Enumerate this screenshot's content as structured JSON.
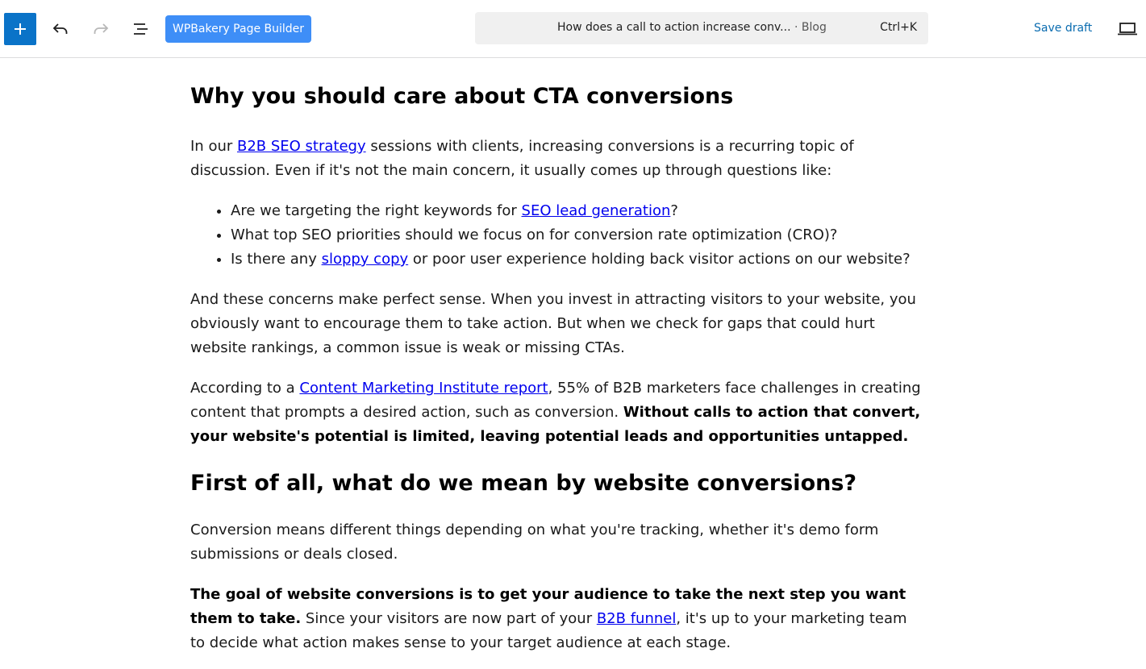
{
  "toolbar": {
    "add_icon": "plus-icon",
    "undo_icon": "undo-icon",
    "redo_icon": "redo-icon",
    "outline_icon": "document-overview-icon",
    "wpbakery_label": "WPBakery Page Builder",
    "doc_title": "How does a call to action increase conv...",
    "doc_type": "· Blog",
    "shortcut": "Ctrl+K",
    "save_draft_label": "Save draft",
    "preview_icon": "laptop-preview-icon",
    "accent_color": "#0a73c8",
    "wpbakery_color": "#3e8ef7"
  },
  "content": {
    "h_care": "Why you should care about CTA conversions",
    "p1": {
      "pre": "In our ",
      "link": "B2B SEO strategy",
      "post": " sessions with clients, increasing conversions is a recurring topic of discussion. Even if it's not the main concern, it usually comes up through questions like:"
    },
    "bullets": [
      {
        "pre": "Are we targeting the right keywords for ",
        "link": "SEO lead generation",
        "post": "?"
      },
      {
        "text": "What top SEO priorities should we focus on for conversion rate optimization (CRO)?"
      },
      {
        "pre": "Is there any ",
        "link": "sloppy copy",
        "post": " or poor user experience holding back visitor actions on our website?"
      }
    ],
    "p2": "And these concerns make perfect sense. When you invest in attracting visitors to your website, you obviously want to encourage them to take action. But when we check for gaps that could hurt website rankings, a common issue is weak or missing CTAs.",
    "p3": {
      "pre": "According to a ",
      "link": "Content Marketing Institute report",
      "mid": ", 55% of B2B marketers face challenges in creating content that prompts a desired action, such as conversion. ",
      "bold": "Without calls to action that convert, your website's potential is limited, leaving potential leads and opportunities untapped."
    },
    "h_first": "First of all, what do we mean by website conversions?",
    "p4": "Conversion means different things depending on what you're tracking, whether it's demo form submissions or deals closed.",
    "p5": {
      "bold": "The goal of website conversions is to get your audience to take the next step you want them to take.",
      "pre": " Since your visitors are now part of your ",
      "link": "B2B funnel",
      "post": ", it's up to your marketing team to decide what action makes sense to your target audience at each stage."
    }
  }
}
